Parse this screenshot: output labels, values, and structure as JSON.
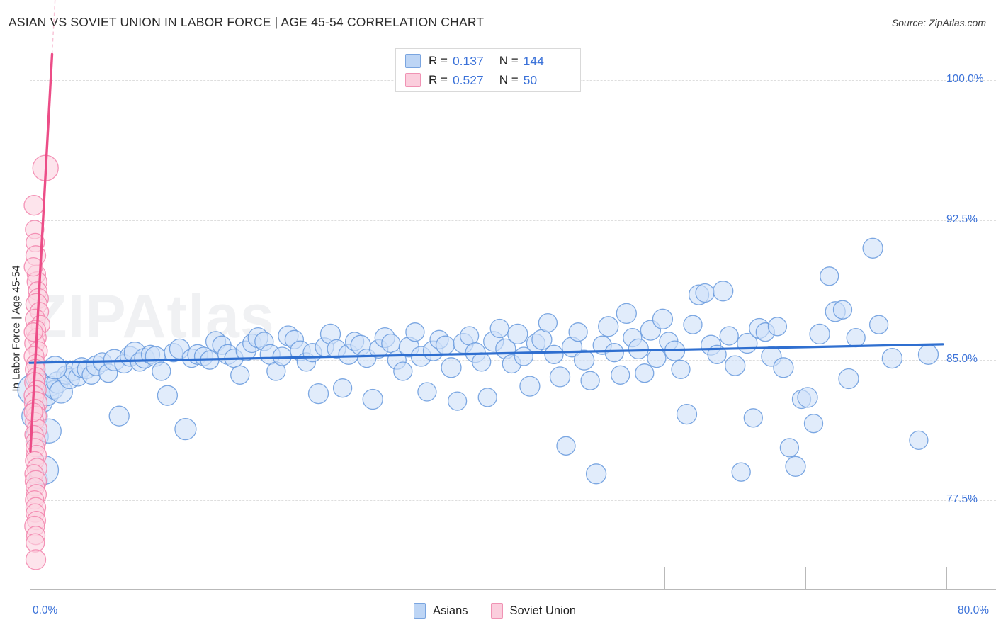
{
  "header": {
    "title": "ASIAN VS SOVIET UNION IN LABOR FORCE | AGE 45-54 CORRELATION CHART",
    "source": "Source: ZipAtlas.com"
  },
  "watermark": "ZIPAtlas",
  "stats": {
    "rows": [
      {
        "swatch": "blue",
        "r_label": "R =",
        "r_value": "0.137",
        "n_label": "N =",
        "n_value": "144"
      },
      {
        "swatch": "pink",
        "r_label": "R =",
        "r_value": "0.527",
        "n_label": "N =",
        "n_value": "50"
      }
    ]
  },
  "legend": {
    "items": [
      {
        "label": "Asians",
        "color": "#bdd5f5",
        "border": "#7aa5e0"
      },
      {
        "label": "Soviet Union",
        "color": "#fbcedd",
        "border": "#f093b4"
      }
    ]
  },
  "colors": {
    "asian_fill": "#cfe0f8",
    "asian_stroke": "#6699dd",
    "soviet_fill": "#fbd3e0",
    "soviet_stroke": "#f283ab",
    "asian_trend": "#2f6fd0",
    "soviet_trend": "#ec4d87",
    "tick_text": "#3b72d9",
    "grid": "#dedede"
  },
  "chart_data": {
    "type": "scatter",
    "title": "ASIAN VS SOVIET UNION IN LABOR FORCE | AGE 45-54 CORRELATION CHART",
    "xlabel": "",
    "ylabel": "In Labor Force | Age 45-54",
    "xlim": [
      0.0,
      80.0
    ],
    "ylim": [
      72.7,
      101.8
    ],
    "grid": true,
    "legend_position": "bottom-center",
    "xticks": [
      "0.0%",
      "80.0%"
    ],
    "xtick_values": [
      0.0,
      80.0
    ],
    "yticks": [
      "100.0%",
      "92.5%",
      "85.0%",
      "77.5%"
    ],
    "ytick_values": [
      100.0,
      92.5,
      85.0,
      77.5
    ],
    "series": [
      {
        "name": "Asians",
        "r": 0.137,
        "n": 144,
        "color": "#cfe0f8",
        "trendline": {
          "x0": 0.0,
          "y0": 84.85,
          "x1": 75.6,
          "y1": 85.85
        },
        "points": [
          [
            0.3,
            83.4,
            22
          ],
          [
            0.4,
            82.0,
            18
          ],
          [
            0.5,
            84.0,
            14
          ],
          [
            0.6,
            80.9,
            16
          ],
          [
            0.7,
            78.6,
            13
          ],
          [
            0.9,
            83.7,
            15
          ],
          [
            1.1,
            82.7,
            13
          ],
          [
            1.4,
            83.2,
            17
          ],
          [
            1.7,
            83.6,
            14
          ],
          [
            2.0,
            83.4,
            13
          ],
          [
            2.3,
            83.8,
            15
          ],
          [
            2.6,
            83.3,
            16
          ],
          [
            3.0,
            84.2,
            13
          ],
          [
            3.3,
            84.0,
            14
          ],
          [
            3.6,
            84.4,
            13
          ],
          [
            4.0,
            84.1,
            13
          ],
          [
            4.3,
            84.6,
            14
          ],
          [
            4.7,
            84.5,
            13
          ],
          [
            5.1,
            84.2,
            13
          ],
          [
            5.5,
            84.7,
            14
          ],
          [
            6.0,
            84.9,
            13
          ],
          [
            6.5,
            84.3,
            13
          ],
          [
            7.0,
            85.0,
            15
          ],
          [
            7.4,
            82.0,
            14
          ],
          [
            7.8,
            84.8,
            13
          ],
          [
            8.3,
            85.2,
            14
          ],
          [
            8.7,
            85.4,
            15
          ],
          [
            9.1,
            84.9,
            13
          ],
          [
            9.5,
            85.1,
            14
          ],
          [
            10.0,
            85.3,
            13
          ],
          [
            10.4,
            85.2,
            14
          ],
          [
            10.9,
            84.4,
            13
          ],
          [
            11.4,
            83.1,
            14
          ],
          [
            11.9,
            85.4,
            13
          ],
          [
            12.4,
            85.6,
            14
          ],
          [
            12.9,
            81.3,
            15
          ],
          [
            13.4,
            85.1,
            13
          ],
          [
            13.9,
            85.3,
            14
          ],
          [
            14.4,
            85.2,
            13
          ],
          [
            14.9,
            85.0,
            13
          ],
          [
            15.4,
            86.0,
            14
          ],
          [
            15.9,
            85.8,
            13
          ],
          [
            16.4,
            85.3,
            14
          ],
          [
            16.9,
            85.1,
            13
          ],
          [
            17.4,
            84.2,
            13
          ],
          [
            17.9,
            85.5,
            14
          ],
          [
            18.4,
            85.9,
            13
          ],
          [
            18.9,
            86.2,
            14
          ],
          [
            19.4,
            86.0,
            13
          ],
          [
            19.9,
            85.3,
            14
          ],
          [
            20.4,
            84.4,
            13
          ],
          [
            20.9,
            85.2,
            13
          ],
          [
            21.4,
            86.3,
            14
          ],
          [
            21.9,
            86.1,
            13
          ],
          [
            22.4,
            85.5,
            14
          ],
          [
            22.9,
            84.9,
            13
          ],
          [
            23.4,
            85.4,
            13
          ],
          [
            23.9,
            83.2,
            14
          ],
          [
            24.4,
            85.7,
            13
          ],
          [
            24.9,
            86.4,
            14
          ],
          [
            25.4,
            85.6,
            13
          ],
          [
            25.9,
            83.5,
            13
          ],
          [
            26.4,
            85.3,
            14
          ],
          [
            26.9,
            86.0,
            13
          ],
          [
            27.4,
            85.8,
            14
          ],
          [
            27.9,
            85.1,
            13
          ],
          [
            28.4,
            82.9,
            14
          ],
          [
            28.9,
            85.6,
            13
          ],
          [
            29.4,
            86.2,
            14
          ],
          [
            29.9,
            85.9,
            13
          ],
          [
            30.4,
            85.0,
            13
          ],
          [
            30.9,
            84.4,
            13
          ],
          [
            31.4,
            85.7,
            14
          ],
          [
            31.9,
            86.5,
            13
          ],
          [
            32.4,
            85.2,
            14
          ],
          [
            32.9,
            83.3,
            13
          ],
          [
            33.4,
            85.5,
            14
          ],
          [
            33.9,
            86.1,
            13
          ],
          [
            34.4,
            85.8,
            13
          ],
          [
            34.9,
            84.6,
            14
          ],
          [
            35.4,
            82.8,
            13
          ],
          [
            35.9,
            85.9,
            14
          ],
          [
            36.4,
            86.3,
            13
          ],
          [
            36.9,
            85.4,
            14
          ],
          [
            37.4,
            84.9,
            13
          ],
          [
            37.9,
            83.0,
            13
          ],
          [
            38.4,
            86.0,
            14
          ],
          [
            38.9,
            86.7,
            13
          ],
          [
            39.4,
            85.6,
            14
          ],
          [
            39.9,
            84.8,
            13
          ],
          [
            40.4,
            86.4,
            14
          ],
          [
            40.9,
            85.2,
            13
          ],
          [
            41.4,
            83.6,
            14
          ],
          [
            41.9,
            85.9,
            13
          ],
          [
            42.4,
            86.1,
            14
          ],
          [
            42.9,
            87.0,
            13
          ],
          [
            43.4,
            85.3,
            13
          ],
          [
            43.9,
            84.1,
            14
          ],
          [
            44.4,
            80.4,
            13
          ],
          [
            44.9,
            85.7,
            14
          ],
          [
            45.4,
            86.5,
            13
          ],
          [
            45.9,
            85.0,
            14
          ],
          [
            46.4,
            83.9,
            13
          ],
          [
            46.9,
            78.9,
            14
          ],
          [
            47.4,
            85.8,
            13
          ],
          [
            47.9,
            86.8,
            14
          ],
          [
            48.4,
            85.4,
            13
          ],
          [
            48.9,
            84.2,
            13
          ],
          [
            49.4,
            87.5,
            14
          ],
          [
            49.9,
            86.2,
            13
          ],
          [
            50.4,
            85.6,
            14
          ],
          [
            50.9,
            84.3,
            13
          ],
          [
            51.4,
            86.6,
            14
          ],
          [
            51.9,
            85.1,
            13
          ],
          [
            52.4,
            87.2,
            14
          ],
          [
            52.9,
            86.0,
            13
          ],
          [
            53.4,
            85.5,
            14
          ],
          [
            53.9,
            84.5,
            13
          ],
          [
            54.4,
            82.1,
            14
          ],
          [
            54.9,
            86.9,
            13
          ],
          [
            55.4,
            88.5,
            14
          ],
          [
            55.9,
            88.6,
            13
          ],
          [
            56.4,
            85.8,
            14
          ],
          [
            56.9,
            85.3,
            13
          ],
          [
            57.4,
            88.7,
            14
          ],
          [
            57.9,
            86.3,
            13
          ],
          [
            58.4,
            84.7,
            14
          ],
          [
            58.9,
            79.0,
            13
          ],
          [
            59.4,
            85.9,
            14
          ],
          [
            59.9,
            81.9,
            13
          ],
          [
            60.4,
            86.7,
            14
          ],
          [
            60.9,
            86.5,
            13
          ],
          [
            61.4,
            85.2,
            14
          ],
          [
            61.9,
            86.8,
            13
          ],
          [
            62.4,
            84.6,
            14
          ],
          [
            62.9,
            80.3,
            13
          ],
          [
            63.4,
            79.3,
            14
          ],
          [
            63.9,
            82.9,
            13
          ],
          [
            64.4,
            83.0,
            14
          ],
          [
            64.9,
            81.6,
            13
          ],
          [
            65.4,
            86.4,
            14
          ],
          [
            66.2,
            89.5,
            13
          ],
          [
            66.7,
            87.6,
            14
          ],
          [
            67.3,
            87.7,
            13
          ],
          [
            67.8,
            84.0,
            14
          ],
          [
            68.4,
            86.2,
            13
          ],
          [
            69.8,
            91.0,
            14
          ],
          [
            70.3,
            86.9,
            13
          ],
          [
            71.4,
            85.1,
            14
          ],
          [
            73.6,
            80.7,
            13
          ],
          [
            74.4,
            85.3,
            14
          ],
          [
            1.2,
            79.1,
            20
          ],
          [
            1.6,
            81.2,
            17
          ],
          [
            2.1,
            84.6,
            16
          ]
        ]
      },
      {
        "name": "Soviet Union",
        "r": 0.527,
        "n": 50,
        "color": "#fbd3e0",
        "trendline": {
          "x0": 0.05,
          "y0": 80.1,
          "x1": 1.85,
          "y1": 101.4
        },
        "points": [
          [
            1.3,
            95.3,
            18
          ],
          [
            0.35,
            93.3,
            14
          ],
          [
            0.4,
            92.0,
            13
          ],
          [
            0.45,
            91.3,
            13
          ],
          [
            0.5,
            90.6,
            14
          ],
          [
            0.55,
            89.6,
            13
          ],
          [
            0.6,
            89.2,
            14
          ],
          [
            0.65,
            88.7,
            13
          ],
          [
            0.72,
            88.3,
            14
          ],
          [
            0.55,
            88.0,
            15
          ],
          [
            0.8,
            87.6,
            13
          ],
          [
            0.45,
            87.2,
            14
          ],
          [
            0.9,
            86.9,
            13
          ],
          [
            0.5,
            86.6,
            14
          ],
          [
            0.6,
            86.2,
            13
          ],
          [
            0.4,
            85.9,
            14
          ],
          [
            0.7,
            85.5,
            13
          ],
          [
            0.35,
            85.2,
            14
          ],
          [
            0.5,
            84.8,
            13
          ],
          [
            0.45,
            84.5,
            14
          ],
          [
            0.55,
            84.1,
            13
          ],
          [
            0.4,
            83.8,
            14
          ],
          [
            0.6,
            83.4,
            13
          ],
          [
            0.35,
            83.1,
            14
          ],
          [
            0.5,
            82.7,
            16
          ],
          [
            0.45,
            82.4,
            13
          ],
          [
            0.55,
            82.0,
            14
          ],
          [
            0.4,
            81.7,
            13
          ],
          [
            0.6,
            81.3,
            14
          ],
          [
            0.35,
            81.0,
            13
          ],
          [
            0.5,
            80.6,
            14
          ],
          [
            0.45,
            80.3,
            13
          ],
          [
            0.55,
            79.9,
            14
          ],
          [
            0.4,
            79.6,
            13
          ],
          [
            0.6,
            79.2,
            14
          ],
          [
            0.35,
            78.9,
            13
          ],
          [
            0.5,
            78.5,
            15
          ],
          [
            0.45,
            78.2,
            13
          ],
          [
            0.55,
            77.8,
            14
          ],
          [
            0.4,
            77.5,
            13
          ],
          [
            0.5,
            77.1,
            14
          ],
          [
            0.45,
            76.8,
            13
          ],
          [
            0.55,
            76.4,
            13
          ],
          [
            0.4,
            76.1,
            14
          ],
          [
            0.5,
            75.6,
            13
          ],
          [
            0.45,
            75.2,
            13
          ],
          [
            0.5,
            74.3,
            14
          ],
          [
            0.3,
            90.0,
            13
          ],
          [
            0.3,
            86.5,
            13
          ],
          [
            0.3,
            82.2,
            13
          ]
        ]
      }
    ]
  }
}
